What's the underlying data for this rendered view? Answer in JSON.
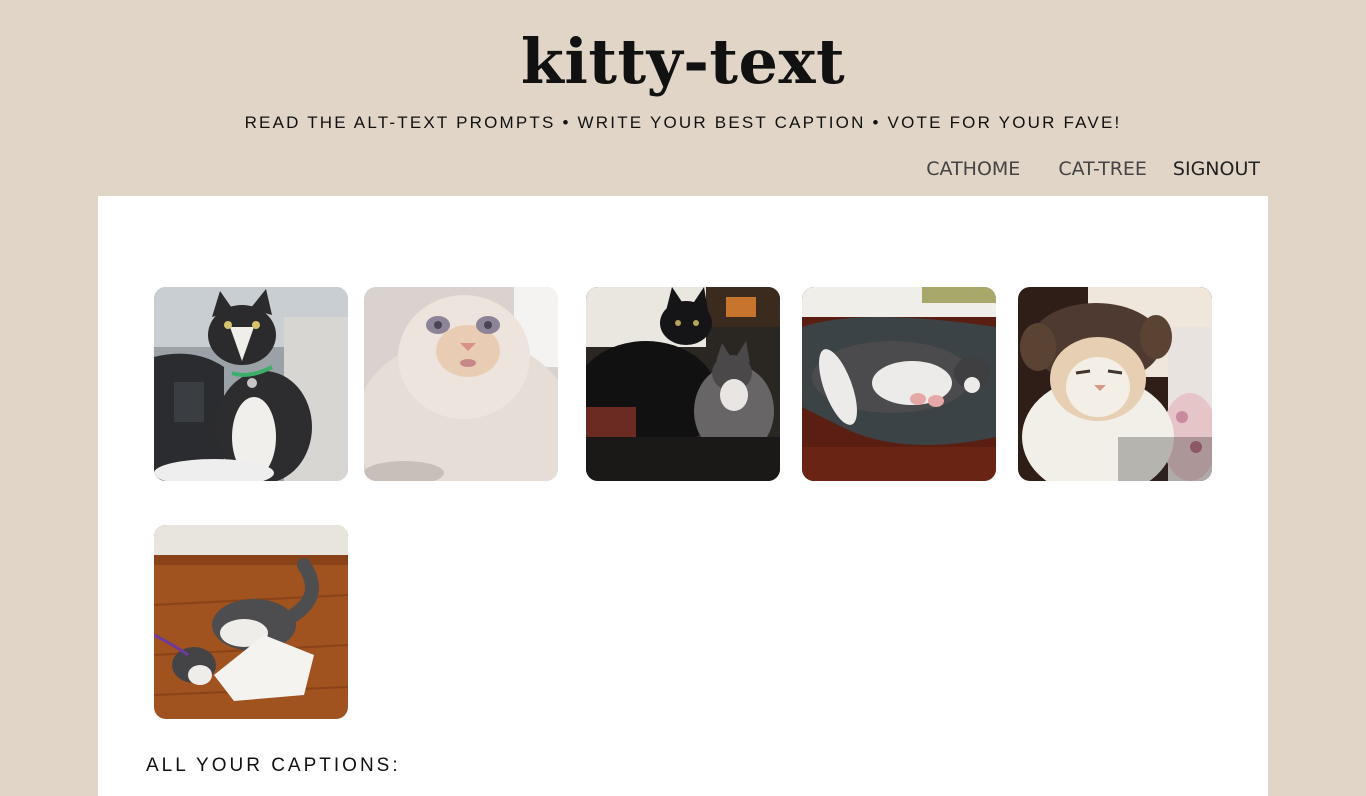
{
  "site": {
    "title": "kitty-text",
    "tagline": "READ THE ALT-TEXT PROMPTS • WRITE YOUR BEST CAPTION • VOTE FOR YOUR FAVE!"
  },
  "nav": {
    "items": [
      {
        "label": "CATHOME"
      },
      {
        "label": "CAT-TREE"
      },
      {
        "label": "SIGNOUT"
      }
    ]
  },
  "gallery": {
    "images": [
      {
        "subject": "tuxedo cat sitting in a car seat"
      },
      {
        "subject": "fluffy cream cat close-up"
      },
      {
        "subject": "black cat and gray-white cat cuddling"
      },
      {
        "subject": "gray-white cat sleeping on its back"
      },
      {
        "subject": "cream cat wearing a costume hat"
      },
      {
        "subject": "gray-white cat playing with paper on wood floor"
      }
    ]
  },
  "captions": {
    "heading": "ALL YOUR CAPTIONS:"
  },
  "colors": {
    "background": "#e0d5c7",
    "panel": "#ffffff",
    "text": "#111111"
  }
}
